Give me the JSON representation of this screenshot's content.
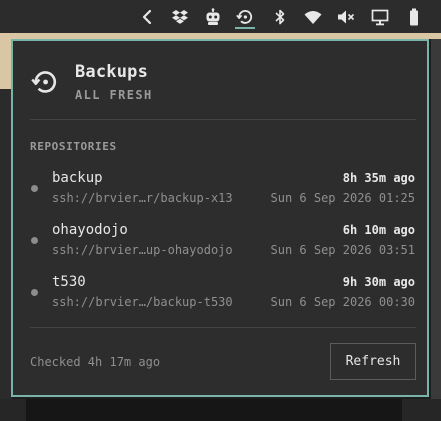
{
  "tray": {
    "icons": [
      "chevron-left-icon",
      "dropbox-icon",
      "robot-icon",
      "backup-history-icon",
      "bluetooth-icon",
      "wifi-icon",
      "volume-muted-icon",
      "display-icon",
      "battery-icon"
    ],
    "active_icon": "backup-history-icon",
    "accent_color": "#7ab3a8"
  },
  "panel": {
    "title": "Backups",
    "status": "ALL FRESH",
    "section_label": "REPOSITORIES",
    "border_color": "#7ab3a8",
    "repositories": [
      {
        "name": "backup",
        "host": "ssh://brvier…r/backup-x13",
        "age": "8h 35m ago",
        "last_backup": "Sun 6 Sep 2026 01:25"
      },
      {
        "name": "ohayodojo",
        "host": "ssh://brvier…up-ohayodojo",
        "age": "6h 10m ago",
        "last_backup": "Sun 6 Sep 2026 03:51"
      },
      {
        "name": "t530",
        "host": "ssh://brvier…/backup-t530",
        "age": "9h 30m ago",
        "last_backup": "Sun 6 Sep 2026 00:30"
      }
    ],
    "checked_text": "Checked 4h 17m ago",
    "refresh_label": "Refresh"
  }
}
